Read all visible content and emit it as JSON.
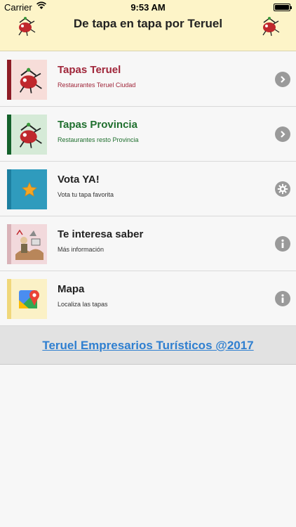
{
  "status_bar": {
    "carrier": "Carrier",
    "time": "9:53 AM"
  },
  "header": {
    "title": "De tapa en tapa por Teruel"
  },
  "items": [
    {
      "label": "Tapas Teruel",
      "sub": "Restaurantes Teruel Ciudad",
      "label_color": "#a0263a",
      "sub_color": "#a0263a",
      "bar_color": "#8e1c26",
      "bg_color": "#f7ddd9",
      "icon": "mascot-icon",
      "action": "chevron-right-icon"
    },
    {
      "label": "Tapas Provincia",
      "sub": "Restaurantes resto Provincia",
      "label_color": "#1f6f2e",
      "sub_color": "#1f6f2e",
      "bar_color": "#14612b",
      "bg_color": "#d5ead7",
      "icon": "mascot-icon",
      "action": "chevron-right-icon"
    },
    {
      "label": "Vota YA!",
      "sub": "Vota tu tapa favorita",
      "label_color": "#222222",
      "sub_color": "#333333",
      "bar_color": "#1d7fa0",
      "bg_color": "#2f9bbd",
      "icon": "star-icon",
      "action": "gear-icon"
    },
    {
      "label": "Te interesa saber",
      "sub": "Más información",
      "label_color": "#222222",
      "sub_color": "#333333",
      "bar_color": "#d9b3b8",
      "bg_color": "#f2d9dc",
      "icon": "history-illustration-icon",
      "action": "info-icon"
    },
    {
      "label": "Mapa",
      "sub": "Localiza las tapas",
      "label_color": "#222222",
      "sub_color": "#333333",
      "bar_color": "#f0d77a",
      "bg_color": "#fbf1c6",
      "icon": "map-pin-icon",
      "action": "info-icon"
    }
  ],
  "footer": {
    "link": "Teruel Empresarios Turísticos @2017"
  }
}
